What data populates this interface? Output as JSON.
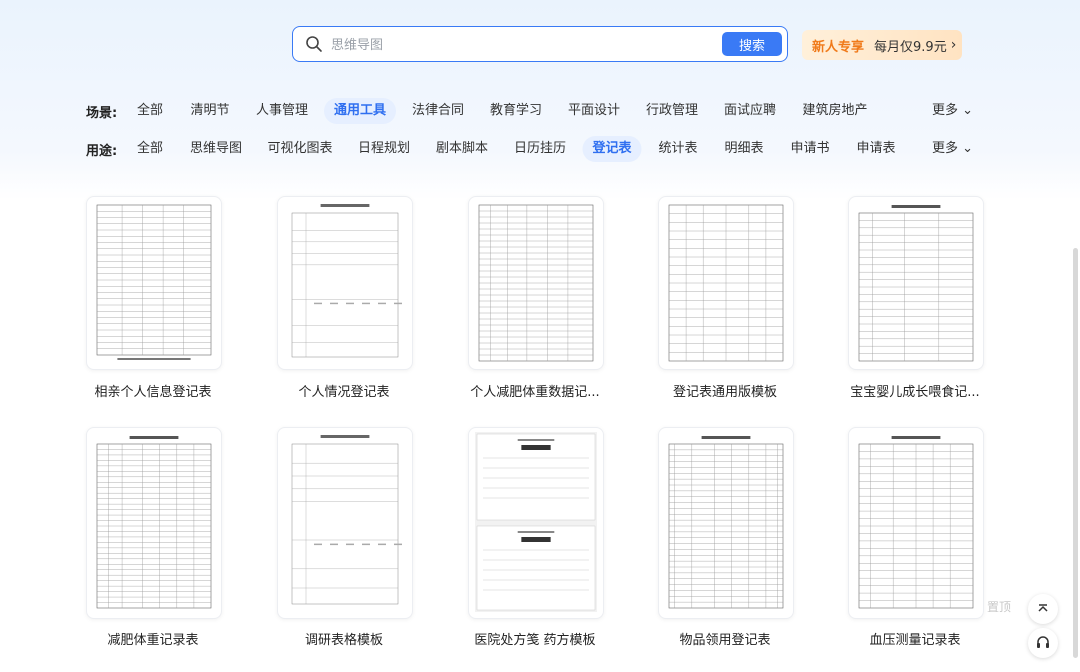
{
  "search": {
    "placeholder": "思维导图",
    "button_label": "搜索"
  },
  "promo": {
    "tag": "新人专享",
    "text": "每月仅9.9元",
    "chevron": "›"
  },
  "filters": {
    "scene": {
      "label": "场景:",
      "items": [
        "全部",
        "清明节",
        "人事管理",
        "通用工具",
        "法律合同",
        "教育学习",
        "平面设计",
        "行政管理",
        "面试应聘",
        "建筑房地产"
      ],
      "active_index": 3,
      "more": "更多 ⌄"
    },
    "usage": {
      "label": "用途:",
      "items": [
        "全部",
        "思维导图",
        "可视化图表",
        "日程规划",
        "剧本脚本",
        "日历挂历",
        "登记表",
        "统计表",
        "明细表",
        "申请书",
        "申请表"
      ],
      "active_index": 6,
      "more": "更多 ⌄"
    }
  },
  "cards": [
    {
      "title": "相亲个人信息登记表"
    },
    {
      "title": "个人情况登记表"
    },
    {
      "title": "个人减肥体重数据记..."
    },
    {
      "title": "登记表通用版模板"
    },
    {
      "title": "宝宝婴儿成长喂食记..."
    },
    {
      "title": "减肥体重记录表"
    },
    {
      "title": "调研表格模板"
    },
    {
      "title": "医院处方笺 药方模板"
    },
    {
      "title": "物品领用登记表"
    },
    {
      "title": "血压测量记录表"
    }
  ],
  "side": {
    "top_label": "置顶",
    "up_icon": "chevron-up-icon",
    "service_icon": "headset-icon"
  }
}
